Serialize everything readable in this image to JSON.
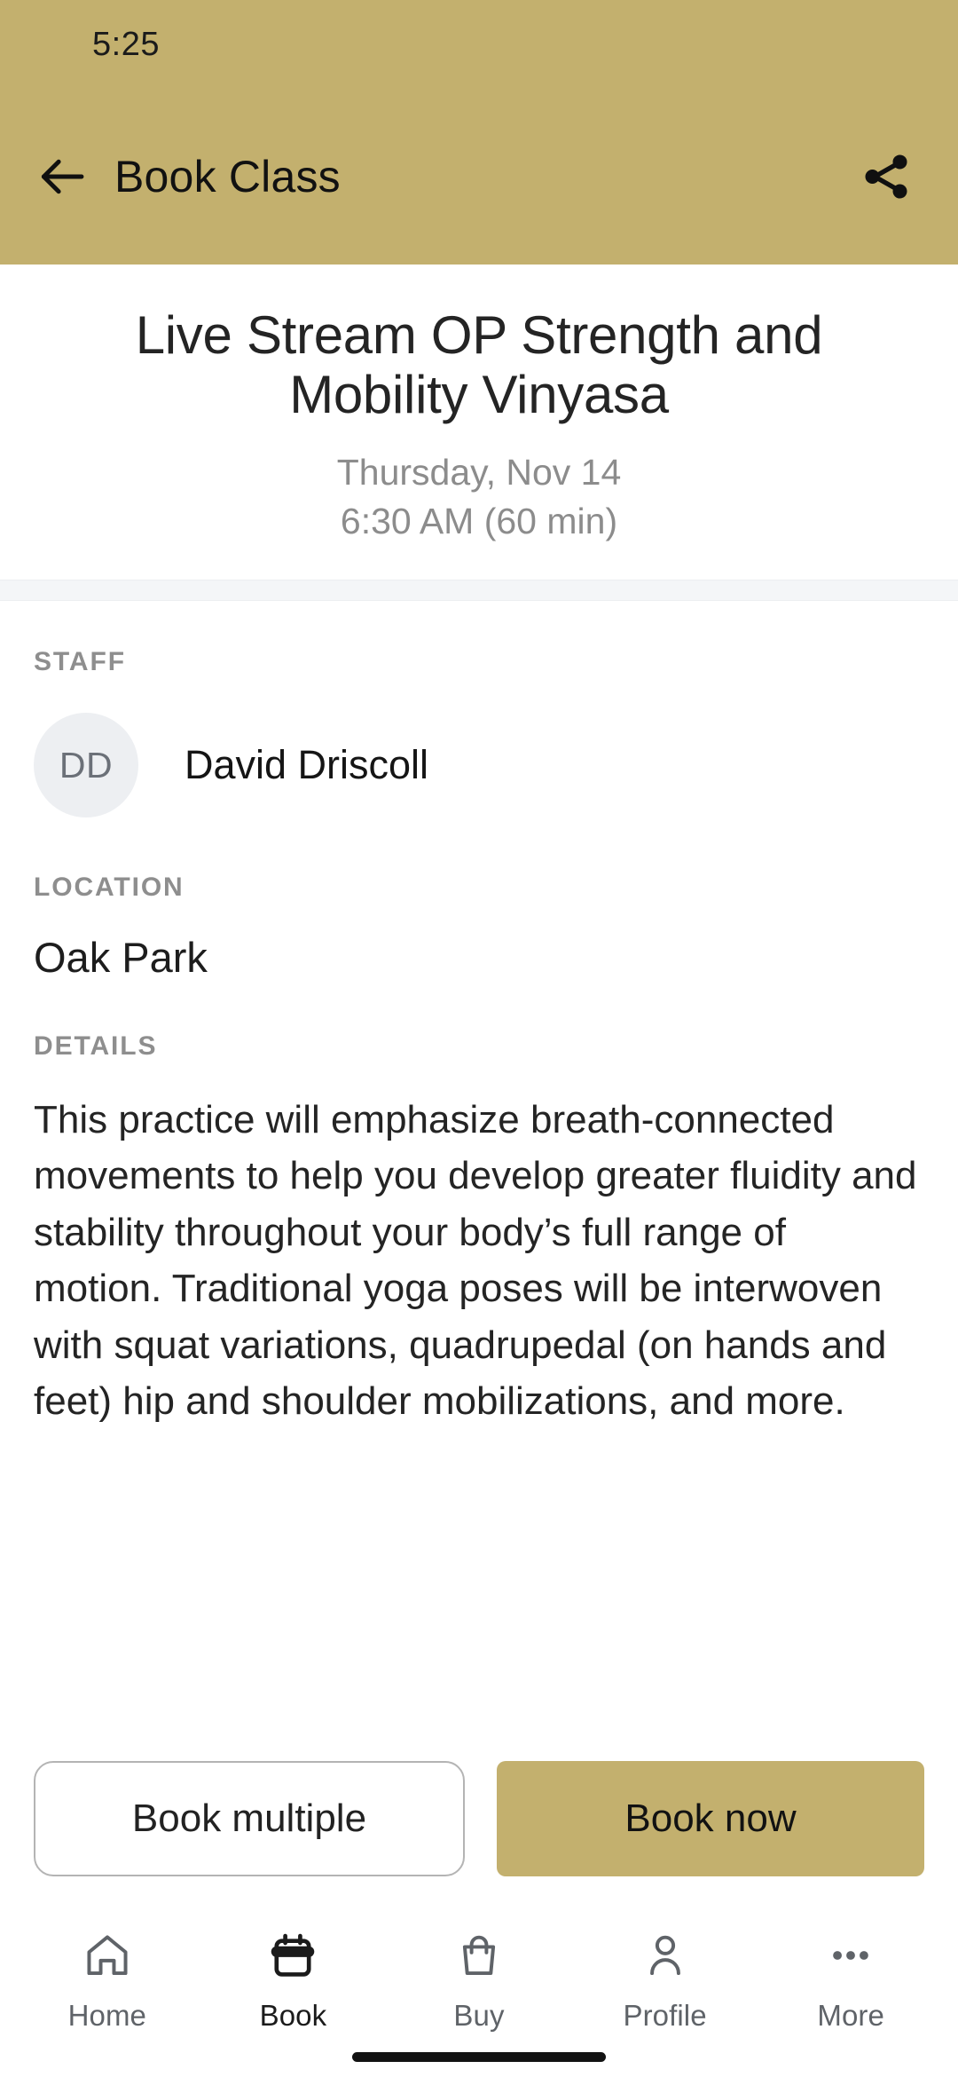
{
  "status_bar": {
    "time": "5:25"
  },
  "app_bar": {
    "title": "Book Class",
    "back_icon": "arrow-left-icon",
    "share_icon": "share-icon",
    "background_color": "#c3b06e"
  },
  "hero": {
    "class_title": "Live Stream OP Strength and Mobility Vinyasa",
    "date": "Thursday, Nov 14",
    "time": "6:30 AM (60 min)"
  },
  "staff": {
    "label": "STAFF",
    "avatar_initials": "DD",
    "name": "David Driscoll"
  },
  "location": {
    "label": "LOCATION",
    "value": "Oak Park"
  },
  "details": {
    "label": "DETAILS",
    "body": "This practice will emphasize breath-connected movements to help you develop greater fluidity and stability throughout your body’s full range of motion. Traditional yoga poses will be interwoven with squat variations, quadrupedal (on hands and feet) hip and shoulder mobilizations, and more."
  },
  "actions": {
    "secondary_label": "Book multiple",
    "primary_label": "Book now",
    "primary_color": "#c3b06e"
  },
  "tabbar": {
    "items": [
      {
        "label": "Home",
        "icon": "home-icon",
        "active": false
      },
      {
        "label": "Book",
        "icon": "calendar-icon",
        "active": true
      },
      {
        "label": "Buy",
        "icon": "shopping-bag-icon",
        "active": false
      },
      {
        "label": "Profile",
        "icon": "person-icon",
        "active": false
      },
      {
        "label": "More",
        "icon": "more-horizontal-icon",
        "active": false
      }
    ]
  }
}
